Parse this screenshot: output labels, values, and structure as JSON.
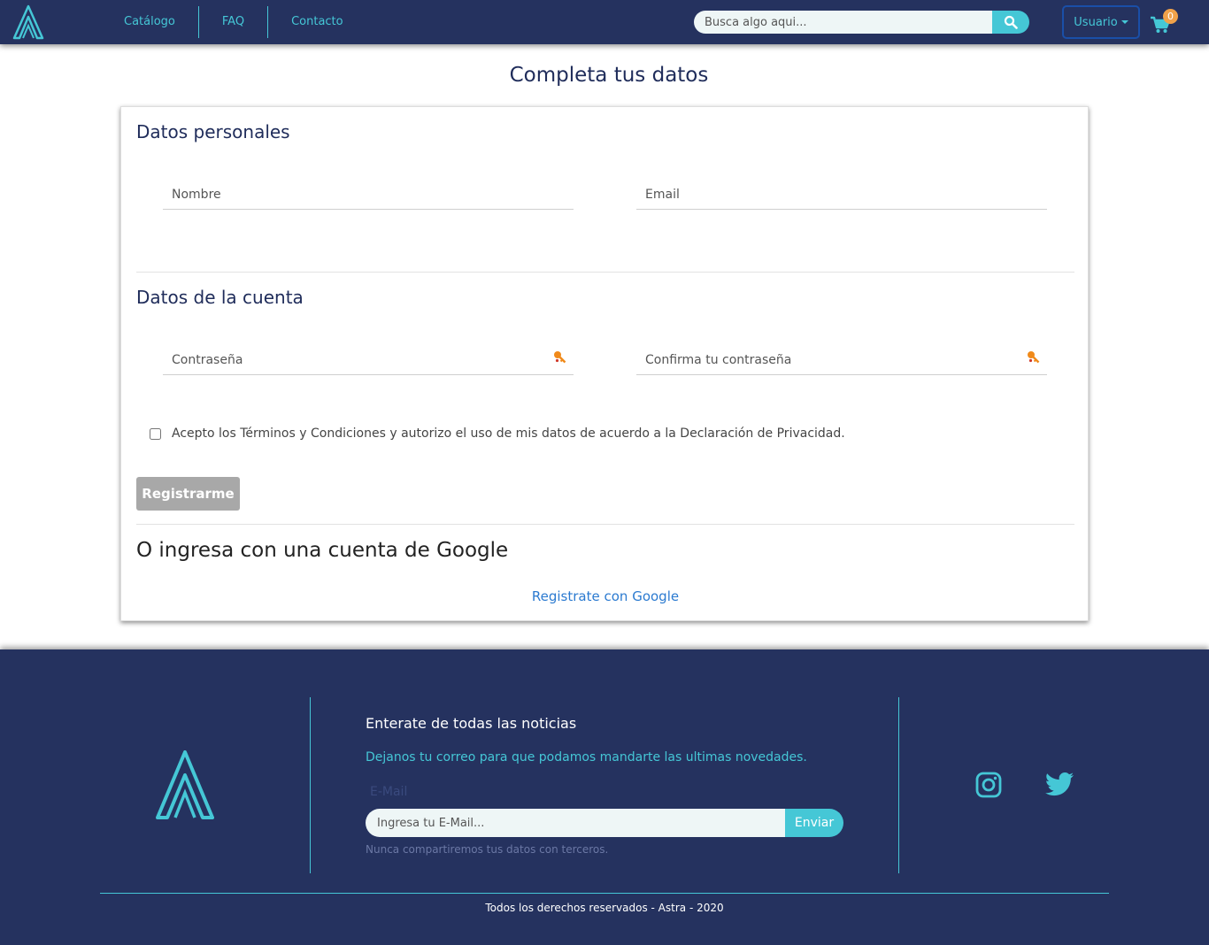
{
  "nav": {
    "links": [
      {
        "label": "Catálogo"
      },
      {
        "label": "FAQ"
      },
      {
        "label": "Contacto"
      }
    ],
    "search_placeholder": "Busca algo aqui...",
    "user_label": "Usuario",
    "cart_count": "0"
  },
  "main": {
    "title": "Completa tus datos",
    "personal_title": "Datos personales",
    "name_placeholder": "Nombre",
    "email_placeholder": "Email",
    "account_title": "Datos de la cuenta",
    "password_placeholder": "Contraseña",
    "confirm_placeholder": "Confirma tu contraseña",
    "terms_text": "Acepto los Términos y Condiciones y autorizo el uso de mis datos de acuerdo a la Declaración de Privacidad.",
    "register_label": "Registrarme",
    "google_title": "O ingresa con una cuenta de Google",
    "google_link": "Registrate con Google"
  },
  "footer": {
    "news_title": "Enterate de todas las noticias",
    "news_sub": "Dejanos tu correo para que podamos mandarte las ultimas novedades.",
    "email_label": "E-Mail",
    "email_placeholder": "Ingresa tu E-Mail...",
    "send_label": "Enviar",
    "note": "Nunca compartiremos tus datos con terceros.",
    "copyright": "Todos los derechos reservados - Astra - 2020"
  },
  "colors": {
    "navy": "#25325f",
    "accent": "#45c7d6",
    "badge": "#f0a24a",
    "link": "#2b7ad0"
  }
}
